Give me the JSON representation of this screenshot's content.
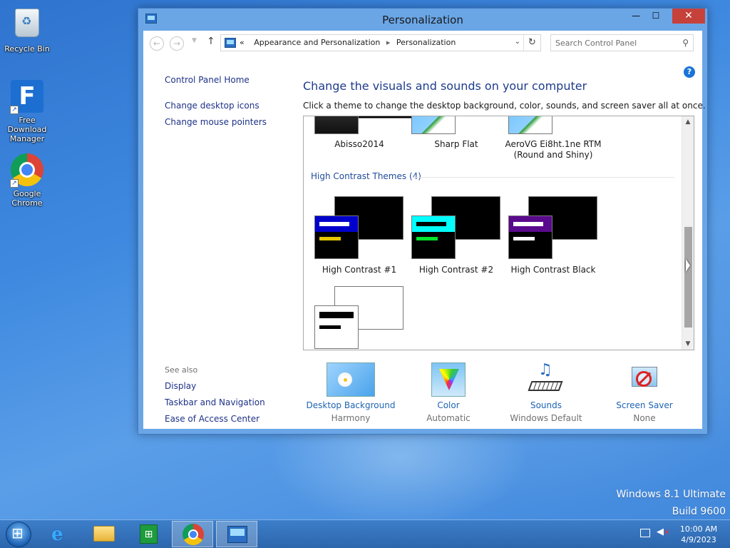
{
  "desktop": {
    "icons": [
      {
        "label": "Recycle Bin"
      },
      {
        "label": "Free Download Manager"
      },
      {
        "label": "Google Chrome"
      }
    ],
    "watermark": {
      "line1": "Windows 8.1 Ultimate",
      "line2": "Build 9600"
    }
  },
  "window": {
    "title": "Personalization",
    "controls": {
      "minimize": "—",
      "maximize": "☐",
      "close": "✕"
    },
    "address": {
      "overflow": "«",
      "crumbs": [
        "Appearance and Personalization",
        "Personalization"
      ]
    },
    "search": {
      "placeholder": "Search Control Panel"
    },
    "left_pane": {
      "home": "Control Panel Home",
      "links": [
        "Change desktop icons",
        "Change mouse pointers"
      ],
      "see_also_title": "See also",
      "see_also": [
        "Display",
        "Taskbar and Navigation",
        "Ease of Access Center"
      ]
    },
    "help": "?",
    "heading": "Change the visuals and sounds on your computer",
    "subtext": "Click a theme to change the desktop background, color, sounds, and screen saver all at once.",
    "themes_partial": [
      {
        "name": "Abisso2014"
      },
      {
        "name": "Sharp Flat"
      },
      {
        "name": "AeroVG Ei8ht.1ne RTM",
        "name2": "(Round and Shiny)"
      }
    ],
    "high_contrast_group": "High Contrast Themes (4)",
    "high_contrast": [
      {
        "name": "High Contrast #1",
        "bar1": "#0a14e6",
        "bar2": "#e6c800",
        "title": "#0000cc"
      },
      {
        "name": "High Contrast #2",
        "bar1": "#00ffff",
        "bar2": "#00e62a",
        "title": "#00ffff"
      },
      {
        "name": "High Contrast Black",
        "bar1": "#5a0a8c",
        "bar2": "#ffffff",
        "title": "#5a0a8c"
      }
    ],
    "tiles": [
      {
        "name": "Desktop Background",
        "value": "Harmony"
      },
      {
        "name": "Color",
        "value": "Automatic"
      },
      {
        "name": "Sounds",
        "value": "Windows Default"
      },
      {
        "name": "Screen Saver",
        "value": "None"
      }
    ]
  },
  "taskbar": {
    "clock": {
      "time": "10:00 AM",
      "date": "4/9/2023"
    }
  }
}
